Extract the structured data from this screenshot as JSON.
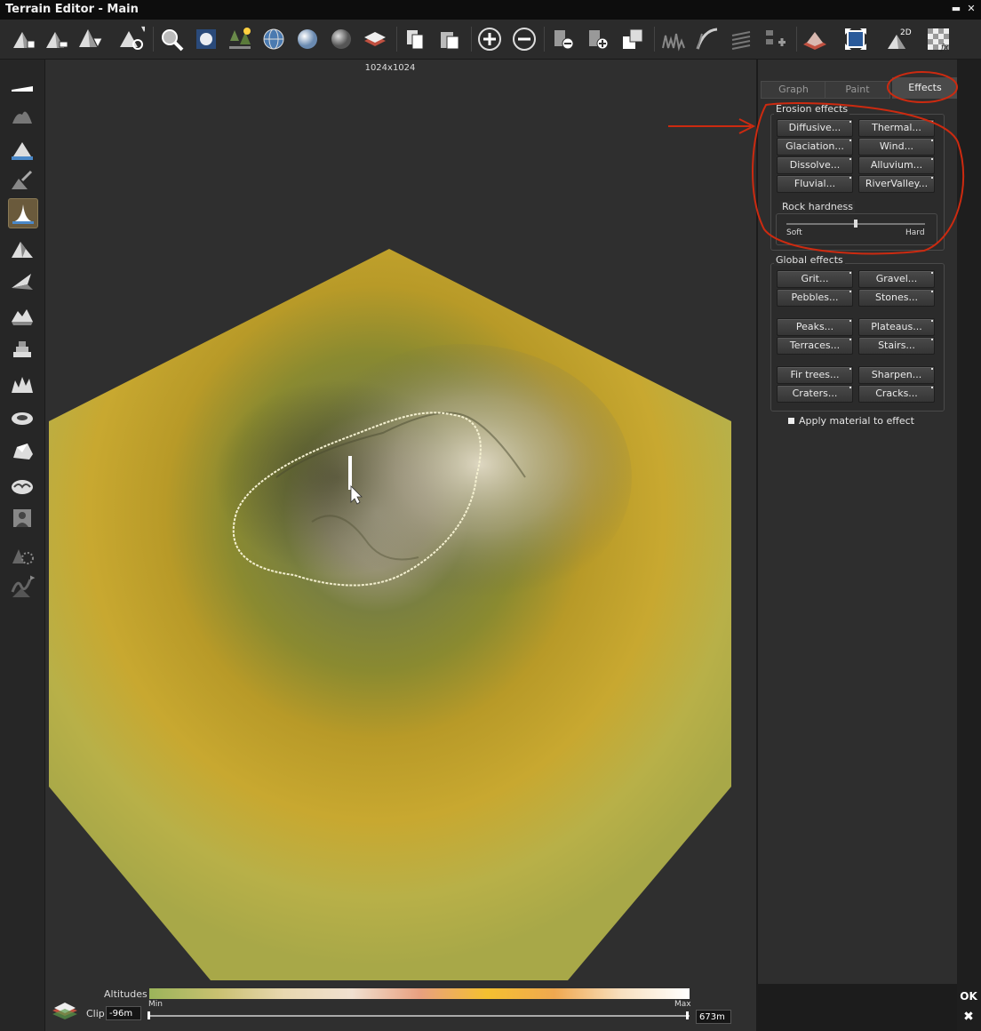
{
  "window": {
    "title": "Terrain Editor - Main",
    "minimize": "▬",
    "close": "✕"
  },
  "toolbar": {
    "buttons": [
      {
        "name": "terrain-add-icon"
      },
      {
        "name": "terrain-remove-icon"
      },
      {
        "name": "terrain-download-icon"
      },
      {
        "name": "terrain-settings-icon"
      },
      {
        "name": "zoom-search-icon"
      },
      {
        "name": "sky-glow-icon"
      },
      {
        "name": "plants-icon"
      },
      {
        "name": "globe-wire-icon"
      },
      {
        "name": "sphere-icon"
      },
      {
        "name": "rock-sphere-icon"
      },
      {
        "name": "material-layer-icon"
      },
      {
        "name": "copy-icon"
      },
      {
        "name": "paste-icon"
      },
      {
        "name": "zoom-in-icon"
      },
      {
        "name": "zoom-out-icon"
      },
      {
        "name": "layer-minus-icon"
      },
      {
        "name": "layer-plus-icon"
      },
      {
        "name": "resize-icon"
      },
      {
        "name": "histogram-icon"
      },
      {
        "name": "curve-icon"
      },
      {
        "name": "filter-icon"
      },
      {
        "name": "add-node-icon"
      },
      {
        "name": "paint-terrain-icon"
      },
      {
        "name": "fit-view-icon"
      },
      {
        "name": "view-2d-icon",
        "label": "2D"
      },
      {
        "name": "checker-fx-icon"
      }
    ]
  },
  "leftbar": {
    "tools": [
      {
        "name": "flatten-tool-icon"
      },
      {
        "name": "smooth-tool-icon"
      },
      {
        "name": "raise-tool-icon"
      },
      {
        "name": "paint-brush-tool-icon"
      },
      {
        "name": "peak-tool-icon",
        "active": true
      },
      {
        "name": "mountain-tool-icon"
      },
      {
        "name": "ridge-tool-icon"
      },
      {
        "name": "hills-tool-icon"
      },
      {
        "name": "terrace-tool-icon"
      },
      {
        "name": "rocky-tool-icon"
      },
      {
        "name": "crater-tool-icon"
      },
      {
        "name": "boulder-tool-icon"
      },
      {
        "name": "dune-tool-icon"
      },
      {
        "name": "portrait-tool-icon"
      },
      {
        "name": "splat-tool-icon"
      },
      {
        "name": "erosion-brush-tool-icon"
      }
    ]
  },
  "viewport": {
    "resolution": "1024x1024"
  },
  "bottombar": {
    "altitudes_label": "Altitudes",
    "clip_label": "Clip",
    "clip_min_value": "-96m",
    "min_label": "Min",
    "max_label": "Max",
    "clip_max_value": "673m",
    "altitude_gradient": [
      "#9bb45a",
      "#c8c070",
      "#e8d8b0",
      "#f0e0d0",
      "#e8a080",
      "#f4c030",
      "#f0a850",
      "#f8e0c0",
      "#ffffff"
    ],
    "clip_range": [
      0,
      1
    ]
  },
  "panel": {
    "tabs": [
      {
        "label": "Graph"
      },
      {
        "label": "Paint"
      },
      {
        "label": "Effects",
        "active": true
      }
    ],
    "erosion": {
      "title": "Erosion effects",
      "buttons": [
        "Diffusive...",
        "Thermal...",
        "Glaciation...",
        "Wind...",
        "Dissolve...",
        "Alluvium...",
        "Fluvial...",
        "RiverValley..."
      ]
    },
    "rock_hardness": {
      "title": "Rock hardness",
      "min_label": "Soft",
      "max_label": "Hard",
      "value": 0.5
    },
    "global": {
      "title": "Global effects",
      "group1": [
        "Grit...",
        "Gravel...",
        "Pebbles...",
        "Stones..."
      ],
      "group2": [
        "Peaks...",
        "Plateaus...",
        "Terraces...",
        "Stairs..."
      ],
      "group3": [
        "Fir trees...",
        "Sharpen...",
        "Craters...",
        "Cracks..."
      ]
    },
    "apply_material": {
      "label": "Apply material to effect",
      "checked": false
    }
  },
  "dialog": {
    "ok_label": "OK",
    "cancel_label": "✖"
  },
  "colors": {
    "annotation": "#cc2a10",
    "active_tool": "#6a5a3c",
    "terrain_base": "#a8a848"
  }
}
